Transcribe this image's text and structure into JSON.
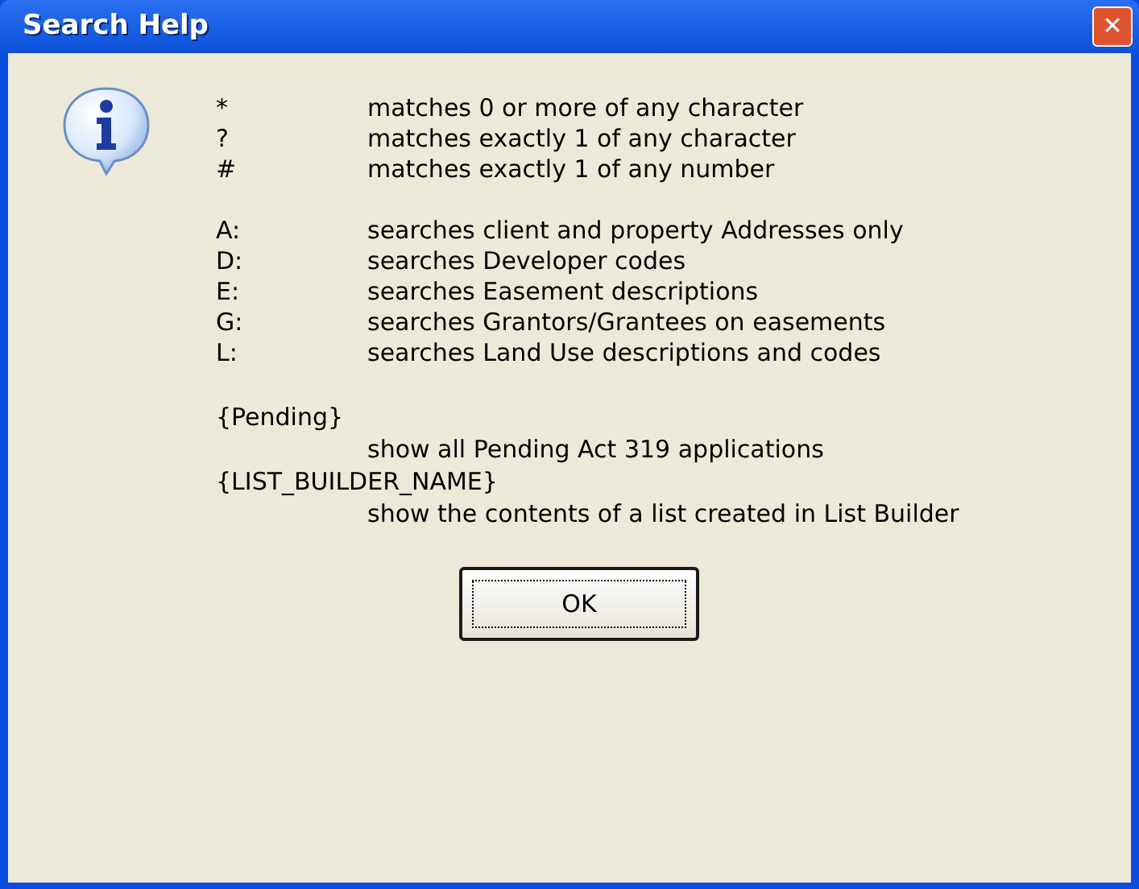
{
  "window": {
    "title": "Search Help",
    "close": "✕"
  },
  "wildcards": [
    {
      "key": "*",
      "description": "matches 0 or more of any character"
    },
    {
      "key": "?",
      "description": "matches exactly 1 of any character"
    },
    {
      "key": "#",
      "description": "matches exactly 1 of any number"
    }
  ],
  "prefixes": [
    {
      "key": "A:",
      "description": "searches client and property Addresses only"
    },
    {
      "key": "D:",
      "description": "searches Developer codes"
    },
    {
      "key": "E:",
      "description": "searches Easement descriptions"
    },
    {
      "key": "G:",
      "description": "searches Grantors/Grantees on easements"
    },
    {
      "key": "L:",
      "description": "searches Land Use descriptions and codes"
    }
  ],
  "specials": [
    {
      "term": "{Pending}",
      "description": "show all Pending Act 319 applications"
    },
    {
      "term": "{LIST_BUILDER_NAME}",
      "description": "show the contents of a list created in List Builder"
    }
  ],
  "buttons": [
    "OK"
  ]
}
